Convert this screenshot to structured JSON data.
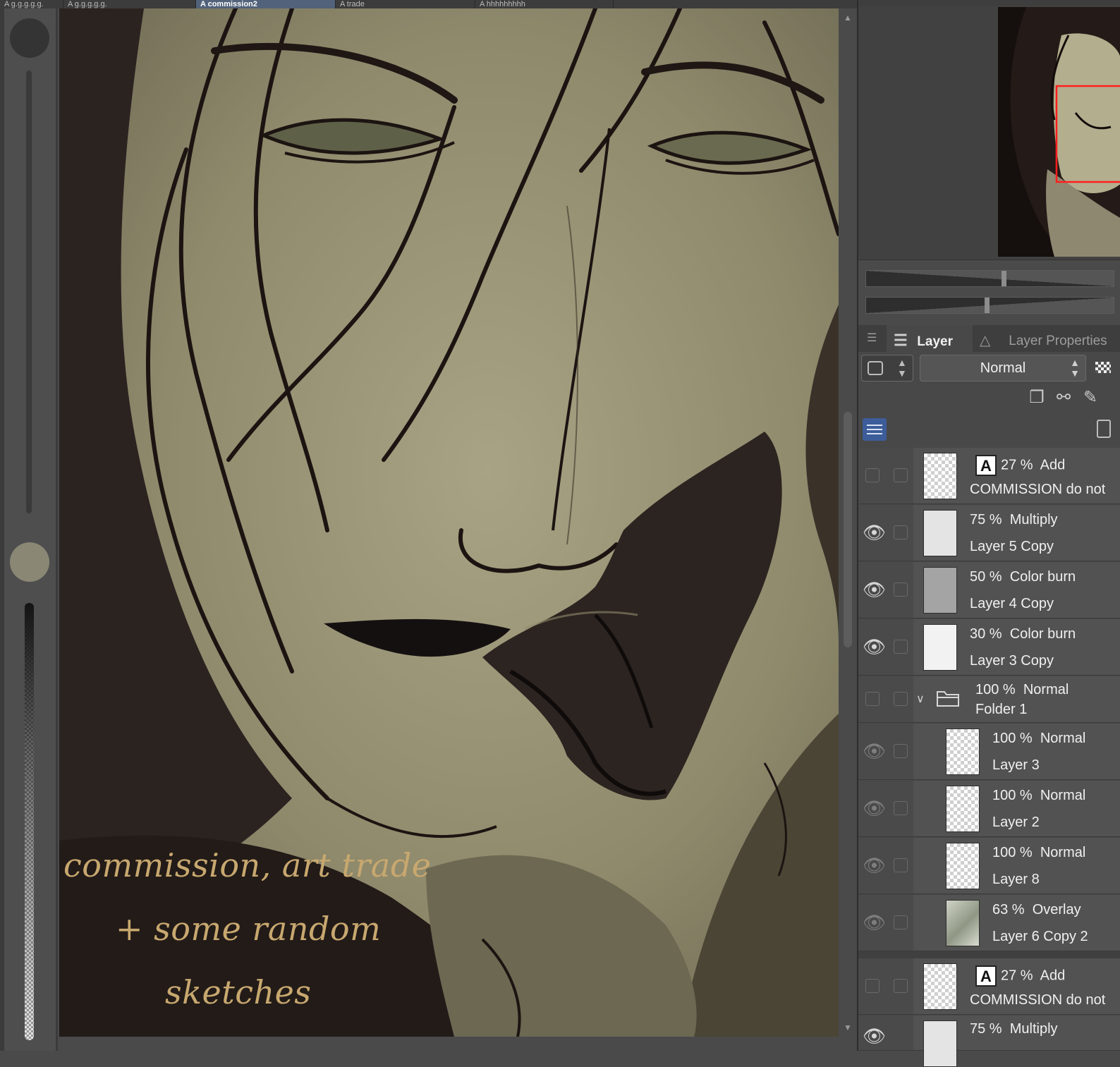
{
  "tabs": [
    {
      "label": "A g.g.g.g.g.",
      "active": false
    },
    {
      "label": "A commission2",
      "active": true
    },
    {
      "label": "A trade",
      "active": false
    },
    {
      "label": "A hhhhhhhhh",
      "active": false
    }
  ],
  "canvas": {
    "caption_lines": [
      "commission, art trade",
      "+ some random",
      "sketches"
    ]
  },
  "panel": {
    "layer_tab": "Layer",
    "properties_tab": "Layer Properties",
    "blend_mode": "Normal"
  },
  "layers": [
    {
      "opacity": "27 %",
      "mode": "Add",
      "name": "COMMISSION do not",
      "visible": false,
      "thumb": "check",
      "text_layer": true
    },
    {
      "opacity": "75 %",
      "mode": "Multiply",
      "name": "Layer 5 Copy",
      "visible": true,
      "thumb": "light",
      "text_layer": false
    },
    {
      "opacity": "50 %",
      "mode": "Color burn",
      "name": "Layer 4 Copy",
      "visible": true,
      "thumb": "gray",
      "text_layer": false
    },
    {
      "opacity": "30 %",
      "mode": "Color burn",
      "name": "Layer 3 Copy",
      "visible": true,
      "thumb": "white",
      "text_layer": false
    },
    {
      "opacity": "100 %",
      "mode": "Normal",
      "name": "Folder 1",
      "visible": false,
      "folder": true
    },
    {
      "opacity": "100 %",
      "mode": "Normal",
      "name": "Layer 3",
      "visible": "dim",
      "thumb": "check",
      "indent": true
    },
    {
      "opacity": "100 %",
      "mode": "Normal",
      "name": "Layer 2",
      "visible": "dim",
      "thumb": "check",
      "indent": true
    },
    {
      "opacity": "100 %",
      "mode": "Normal",
      "name": "Layer 8",
      "visible": "dim",
      "thumb": "check",
      "indent": true
    },
    {
      "opacity": "63 %",
      "mode": "Overlay",
      "name": "Layer 6 Copy 2",
      "visible": "dim",
      "thumb": "photo",
      "indent": true
    },
    {
      "opacity": "27 %",
      "mode": "Add",
      "name": "COMMISSION do not",
      "visible": false,
      "thumb": "check",
      "text_layer": true
    },
    {
      "opacity": "75 %",
      "mode": "Multiply",
      "name": "",
      "visible": true,
      "thumb": "light",
      "text_layer": false
    }
  ],
  "icons": {
    "layers_tab": "layers-icon",
    "properties_tab": "layer-properties-icon",
    "tools": [
      "duplicate-layer-icon",
      "reference-layer-icon",
      "clip-layer-icon"
    ]
  },
  "colors": {
    "active_tab": "#52627a",
    "list_button": "#3d5d9a",
    "caption": "#c8a86f",
    "nav_frame": "#ff1e1e"
  }
}
